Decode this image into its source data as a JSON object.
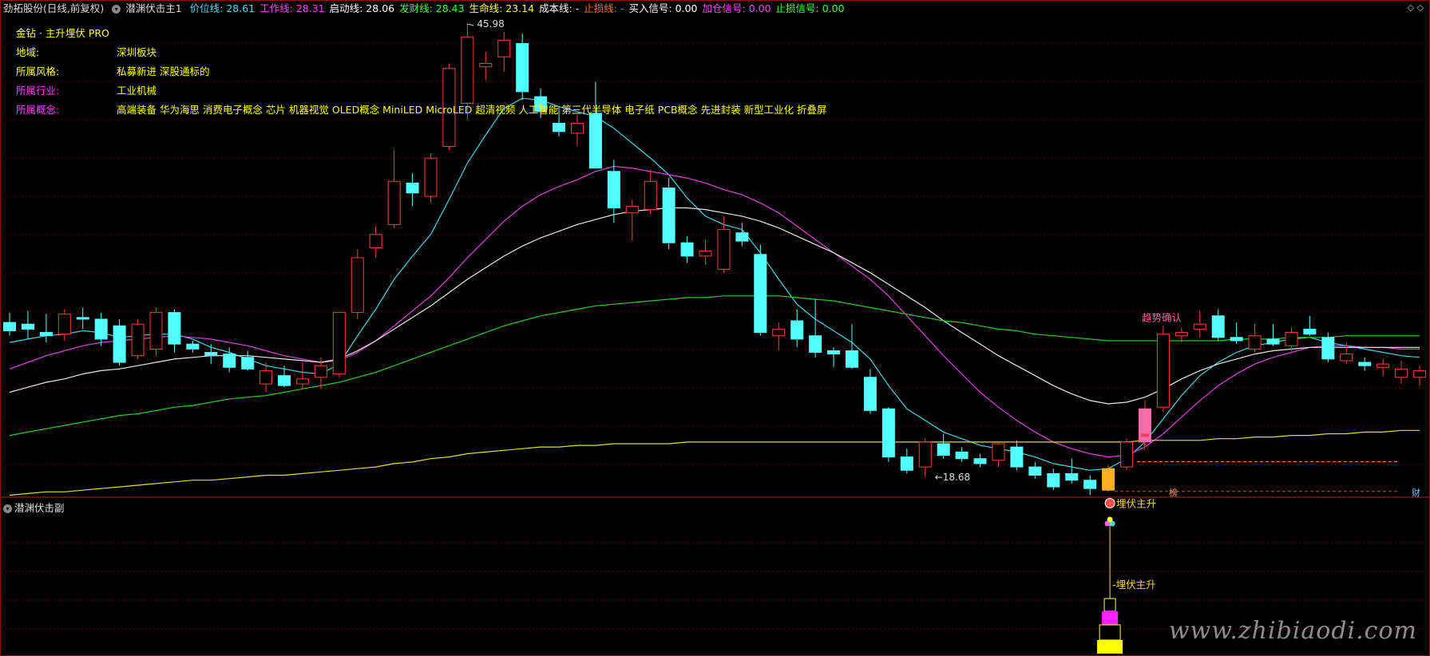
{
  "header": {
    "title": "劲拓股份(日线,前复权)",
    "indicator_name": "潜渊伏击主1",
    "values": [
      {
        "label": "价位线: 28.61",
        "color": "#4fd8ff"
      },
      {
        "label": "工作线: 28.31",
        "color": "#ff40ff"
      },
      {
        "label": "启动线: 28.06",
        "color": "#ffffff"
      },
      {
        "label": "发财线: 28.43",
        "color": "#33ff33"
      },
      {
        "label": "生命线: 23.14",
        "color": "#ffff40"
      },
      {
        "label": "成本线: -",
        "color": "#ffffff"
      },
      {
        "label": "止损线: -",
        "color": "#ff6a00"
      },
      {
        "label": "买入信号: 0.00",
        "color": "#ffffff"
      },
      {
        "label": "加仓信号: 0.00",
        "color": "#ff40ff"
      },
      {
        "label": "止损信号: 0.00",
        "color": "#33ff33"
      }
    ]
  },
  "info": {
    "title": "金钻 · 主升埋伏 PRO",
    "rows": [
      {
        "key": "地域:",
        "value": "深圳板块",
        "key_color": "#ffff40"
      },
      {
        "key": "所属风格:",
        "value": "私募新进 深股通标的",
        "key_color": "#ffff40"
      },
      {
        "key": "所属行业:",
        "value": "工业机械",
        "key_color": "#ff40ff"
      },
      {
        "key": "所属概念:",
        "value": "高端装备 华为海思 消费电子概念 芯片 机器视觉 OLED概念 MiniLED MicroLED 超清视频 人工智能 第三代半导体 电子纸 PCB概念 先进封装 新型工业化 折叠屏",
        "key_color": "#ff40ff"
      }
    ]
  },
  "annotations": {
    "high": "45.98",
    "low": "18.68",
    "trend_confirm": "趋势确认",
    "ambush": "埋伏主升",
    "ambush_sub": "埋伏主升",
    "badge_left": "榜",
    "badge_right": "财"
  },
  "sub_panel": {
    "title": "潜渊伏击副"
  },
  "watermark": "www.zhibiaodi.com",
  "chart_data": {
    "type": "candlestick",
    "price_range": [
      18.68,
      45.98
    ],
    "candles": [
      {
        "o": 28.0,
        "h": 28.6,
        "l": 27.2,
        "c": 27.5
      },
      {
        "o": 27.9,
        "h": 28.7,
        "l": 27.0,
        "c": 27.6
      },
      {
        "o": 27.4,
        "h": 28.5,
        "l": 26.8,
        "c": 27.2
      },
      {
        "o": 27.3,
        "h": 28.8,
        "l": 26.9,
        "c": 28.5
      },
      {
        "o": 28.3,
        "h": 28.9,
        "l": 27.6,
        "c": 28.2
      },
      {
        "o": 28.2,
        "h": 28.6,
        "l": 26.6,
        "c": 27.0
      },
      {
        "o": 27.8,
        "h": 28.2,
        "l": 25.4,
        "c": 25.6
      },
      {
        "o": 26.0,
        "h": 28.2,
        "l": 25.8,
        "c": 27.9
      },
      {
        "o": 26.4,
        "h": 28.9,
        "l": 26.0,
        "c": 28.6
      },
      {
        "o": 28.6,
        "h": 28.8,
        "l": 26.2,
        "c": 26.7
      },
      {
        "o": 26.7,
        "h": 26.9,
        "l": 26.2,
        "c": 26.4
      },
      {
        "o": 26.2,
        "h": 26.7,
        "l": 25.5,
        "c": 26.0
      },
      {
        "o": 26.1,
        "h": 26.5,
        "l": 25.0,
        "c": 25.3
      },
      {
        "o": 25.9,
        "h": 26.3,
        "l": 25.1,
        "c": 25.2
      },
      {
        "o": 24.3,
        "h": 25.6,
        "l": 23.8,
        "c": 25.1
      },
      {
        "o": 24.8,
        "h": 25.4,
        "l": 24.1,
        "c": 24.2
      },
      {
        "o": 24.3,
        "h": 25.6,
        "l": 24.0,
        "c": 24.6
      },
      {
        "o": 24.7,
        "h": 25.9,
        "l": 24.0,
        "c": 25.4
      },
      {
        "o": 24.9,
        "h": 27.1,
        "l": 24.7,
        "c": 28.6
      },
      {
        "o": 28.6,
        "h": 32.4,
        "l": 28.2,
        "c": 31.9
      },
      {
        "o": 32.5,
        "h": 33.8,
        "l": 31.9,
        "c": 33.3
      },
      {
        "o": 33.9,
        "h": 38.4,
        "l": 33.7,
        "c": 36.5
      },
      {
        "o": 36.4,
        "h": 37.0,
        "l": 35.0,
        "c": 35.8
      },
      {
        "o": 35.6,
        "h": 38.2,
        "l": 35.2,
        "c": 37.9
      },
      {
        "o": 38.6,
        "h": 43.6,
        "l": 38.4,
        "c": 43.3
      },
      {
        "o": 41.2,
        "h": 45.98,
        "l": 40.2,
        "c": 45.2
      },
      {
        "o": 43.4,
        "h": 44.3,
        "l": 42.6,
        "c": 43.6
      },
      {
        "o": 44.0,
        "h": 45.5,
        "l": 43.1,
        "c": 45.0
      },
      {
        "o": 44.8,
        "h": 45.4,
        "l": 41.4,
        "c": 41.9
      },
      {
        "o": 41.6,
        "h": 42.1,
        "l": 40.3,
        "c": 40.7
      },
      {
        "o": 40.0,
        "h": 41.0,
        "l": 39.2,
        "c": 39.5
      },
      {
        "o": 39.4,
        "h": 40.5,
        "l": 38.6,
        "c": 40.0
      },
      {
        "o": 40.6,
        "h": 42.5,
        "l": 38.4,
        "c": 37.3
      },
      {
        "o": 37.1,
        "h": 37.8,
        "l": 34.0,
        "c": 34.9
      },
      {
        "o": 34.6,
        "h": 35.4,
        "l": 32.9,
        "c": 35.0
      },
      {
        "o": 34.8,
        "h": 37.2,
        "l": 34.5,
        "c": 36.5
      },
      {
        "o": 36.1,
        "h": 36.7,
        "l": 32.4,
        "c": 32.8
      },
      {
        "o": 32.8,
        "h": 33.2,
        "l": 31.6,
        "c": 32.0
      },
      {
        "o": 32.0,
        "h": 33.0,
        "l": 31.5,
        "c": 32.3
      },
      {
        "o": 31.2,
        "h": 34.4,
        "l": 31.0,
        "c": 33.6
      },
      {
        "o": 33.4,
        "h": 34.0,
        "l": 32.6,
        "c": 32.9
      },
      {
        "o": 32.1,
        "h": 32.7,
        "l": 27.2,
        "c": 27.4
      },
      {
        "o": 27.2,
        "h": 28.0,
        "l": 26.3,
        "c": 27.6
      },
      {
        "o": 28.1,
        "h": 28.8,
        "l": 26.5,
        "c": 27.0
      },
      {
        "o": 27.2,
        "h": 29.4,
        "l": 25.9,
        "c": 26.2
      },
      {
        "o": 26.3,
        "h": 26.5,
        "l": 25.3,
        "c": 26.1
      },
      {
        "o": 26.3,
        "h": 27.9,
        "l": 25.2,
        "c": 25.3
      },
      {
        "o": 24.7,
        "h": 25.2,
        "l": 22.5,
        "c": 22.7
      },
      {
        "o": 22.8,
        "h": 22.9,
        "l": 19.6,
        "c": 19.9
      },
      {
        "o": 19.9,
        "h": 20.4,
        "l": 18.9,
        "c": 19.1
      },
      {
        "o": 19.3,
        "h": 21.0,
        "l": 18.68,
        "c": 20.8
      },
      {
        "o": 20.7,
        "h": 21.3,
        "l": 19.8,
        "c": 20.0
      },
      {
        "o": 20.2,
        "h": 20.5,
        "l": 19.6,
        "c": 19.8
      },
      {
        "o": 19.8,
        "h": 20.1,
        "l": 19.3,
        "c": 19.5
      },
      {
        "o": 19.7,
        "h": 20.8,
        "l": 19.3,
        "c": 20.7
      },
      {
        "o": 20.5,
        "h": 20.9,
        "l": 19.1,
        "c": 19.3
      },
      {
        "o": 19.3,
        "h": 19.6,
        "l": 18.6,
        "c": 18.8
      },
      {
        "o": 18.9,
        "h": 19.2,
        "l": 17.9,
        "c": 18.1
      },
      {
        "o": 18.9,
        "h": 19.8,
        "l": 18.3,
        "c": 18.5
      },
      {
        "o": 18.5,
        "h": 18.8,
        "l": 17.6,
        "c": 18.0
      },
      {
        "o": 17.9,
        "h": 19.4,
        "l": 17.8,
        "c": 19.2
      },
      {
        "o": 19.3,
        "h": 21.0,
        "l": 19.1,
        "c": 20.8
      },
      {
        "o": 20.8,
        "h": 23.3,
        "l": 20.6,
        "c": 22.8
      },
      {
        "o": 22.9,
        "h": 27.8,
        "l": 22.6,
        "c": 27.3
      },
      {
        "o": 27.2,
        "h": 27.7,
        "l": 26.8,
        "c": 27.4
      },
      {
        "o": 27.6,
        "h": 28.7,
        "l": 27.1,
        "c": 27.9
      },
      {
        "o": 28.4,
        "h": 28.8,
        "l": 26.9,
        "c": 27.1
      },
      {
        "o": 27.1,
        "h": 28.0,
        "l": 26.7,
        "c": 26.9
      },
      {
        "o": 26.4,
        "h": 27.9,
        "l": 26.2,
        "c": 27.2
      },
      {
        "o": 27.0,
        "h": 27.9,
        "l": 26.6,
        "c": 26.7
      },
      {
        "o": 26.6,
        "h": 27.7,
        "l": 26.3,
        "c": 27.4
      },
      {
        "o": 27.6,
        "h": 28.4,
        "l": 27.2,
        "c": 27.3
      },
      {
        "o": 27.1,
        "h": 27.4,
        "l": 25.6,
        "c": 25.8
      },
      {
        "o": 25.7,
        "h": 26.8,
        "l": 25.5,
        "c": 26.1
      },
      {
        "o": 25.6,
        "h": 25.9,
        "l": 25.1,
        "c": 25.4
      },
      {
        "o": 25.3,
        "h": 25.8,
        "l": 24.8,
        "c": 25.5
      },
      {
        "o": 24.7,
        "h": 25.7,
        "l": 24.3,
        "c": 25.2
      },
      {
        "o": 24.7,
        "h": 25.4,
        "l": 24.2,
        "c": 25.1
      }
    ],
    "lines": [
      {
        "name": "价位线",
        "color": "#3fd6e8",
        "values": [
          26.8,
          27.0,
          27.2,
          27.3,
          27.5,
          27.4,
          27.1,
          27.2,
          27.3,
          27.3,
          27.0,
          26.5,
          26.2,
          25.8,
          25.4,
          25.2,
          25.0,
          24.9,
          25.5,
          27.2,
          28.8,
          30.6,
          32.0,
          33.3,
          35.4,
          37.6,
          39.3,
          40.9,
          41.5,
          41.4,
          41.0,
          40.7,
          40.4,
          39.7,
          38.8,
          37.9,
          36.9,
          35.5,
          34.4,
          33.9,
          33.6,
          32.2,
          30.6,
          29.1,
          28.2,
          27.5,
          26.8,
          25.8,
          24.2,
          22.8,
          22.1,
          21.4,
          21.0,
          20.6,
          20.4,
          20.2,
          19.9,
          19.5,
          19.3,
          19.1,
          19.2,
          19.8,
          20.8,
          22.2,
          23.6,
          24.8,
          25.6,
          26.2,
          26.6,
          26.8,
          27.0,
          27.1,
          26.8,
          26.6,
          26.4,
          26.2,
          26.0,
          25.9
        ]
      },
      {
        "name": "工作线",
        "color": "#e040e0",
        "values": [
          25.2,
          25.6,
          26.0,
          26.3,
          26.6,
          26.8,
          26.9,
          27.0,
          27.1,
          27.2,
          27.1,
          27.0,
          26.8,
          26.6,
          26.3,
          26.0,
          25.8,
          25.6,
          25.7,
          26.2,
          26.9,
          27.8,
          28.7,
          29.6,
          30.7,
          31.9,
          33.0,
          34.1,
          35.0,
          35.7,
          36.2,
          36.6,
          37.1,
          37.4,
          37.3,
          37.1,
          36.9,
          36.7,
          36.4,
          36.0,
          35.7,
          35.2,
          34.6,
          33.8,
          33.0,
          32.2,
          31.4,
          30.6,
          29.6,
          28.4,
          27.2,
          26.0,
          24.9,
          23.8,
          22.9,
          22.1,
          21.4,
          20.8,
          20.4,
          20.1,
          19.9,
          20.0,
          20.5,
          21.3,
          22.3,
          23.3,
          24.2,
          24.9,
          25.5,
          25.9,
          26.2,
          26.5,
          26.6,
          26.6,
          26.5,
          26.5,
          26.4,
          26.4
        ]
      },
      {
        "name": "启动线",
        "color": "#e8e8e8",
        "values": [
          23.8,
          24.1,
          24.4,
          24.6,
          24.9,
          25.1,
          25.2,
          25.4,
          25.6,
          25.8,
          25.9,
          26.0,
          26.0,
          26.0,
          25.9,
          25.8,
          25.7,
          25.6,
          25.8,
          26.3,
          26.9,
          27.6,
          28.3,
          29.0,
          29.8,
          30.6,
          31.3,
          32.0,
          32.6,
          33.1,
          33.5,
          33.9,
          34.2,
          34.5,
          34.7,
          34.8,
          34.9,
          34.9,
          34.8,
          34.6,
          34.4,
          34.1,
          33.7,
          33.2,
          32.7,
          32.2,
          31.6,
          31.0,
          30.3,
          29.6,
          28.9,
          28.1,
          27.4,
          26.7,
          26.0,
          25.4,
          24.8,
          24.2,
          23.7,
          23.3,
          23.1,
          23.2,
          23.5,
          24.0,
          24.6,
          25.1,
          25.5,
          25.8,
          26.1,
          26.3,
          26.4,
          26.5,
          26.5,
          26.5,
          26.5,
          26.5,
          26.5,
          26.5
        ]
      },
      {
        "name": "发财线",
        "color": "#22cc22",
        "values": [
          21.2,
          21.4,
          21.6,
          21.8,
          22.0,
          22.2,
          22.4,
          22.5,
          22.7,
          22.9,
          23.0,
          23.2,
          23.4,
          23.5,
          23.6,
          23.8,
          24.0,
          24.2,
          24.4,
          24.7,
          25.0,
          25.4,
          25.8,
          26.2,
          26.6,
          27.0,
          27.4,
          27.8,
          28.1,
          28.4,
          28.6,
          28.8,
          29.0,
          29.1,
          29.2,
          29.3,
          29.4,
          29.5,
          29.5,
          29.6,
          29.6,
          29.6,
          29.6,
          29.5,
          29.4,
          29.3,
          29.1,
          28.9,
          28.7,
          28.5,
          28.3,
          28.1,
          28.0,
          27.8,
          27.6,
          27.5,
          27.3,
          27.2,
          27.1,
          27.0,
          26.9,
          26.9,
          26.9,
          26.9,
          26.9,
          26.9,
          26.9,
          27.0,
          27.0,
          27.0,
          27.1,
          27.1,
          27.1,
          27.2,
          27.2,
          27.2,
          27.2,
          27.2
        ]
      },
      {
        "name": "生命线",
        "color": "#e0e020",
        "values": [
          17.6,
          17.7,
          17.8,
          17.8,
          17.9,
          18.0,
          18.1,
          18.2,
          18.3,
          18.4,
          18.5,
          18.5,
          18.6,
          18.7,
          18.8,
          18.8,
          18.9,
          19.0,
          19.1,
          19.2,
          19.3,
          19.5,
          19.6,
          19.8,
          19.9,
          20.1,
          20.2,
          20.3,
          20.4,
          20.5,
          20.5,
          20.6,
          20.6,
          20.7,
          20.7,
          20.7,
          20.7,
          20.8,
          20.8,
          20.8,
          20.8,
          20.8,
          20.8,
          20.8,
          20.8,
          20.8,
          20.8,
          20.8,
          20.8,
          20.8,
          20.8,
          20.8,
          20.8,
          20.8,
          20.8,
          20.8,
          20.8,
          20.8,
          20.8,
          20.8,
          20.8,
          20.8,
          20.9,
          20.9,
          20.9,
          20.9,
          21.0,
          21.0,
          21.1,
          21.1,
          21.2,
          21.2,
          21.3,
          21.3,
          21.4,
          21.4,
          21.5,
          21.5
        ]
      }
    ],
    "signals": {
      "buy_index": 60,
      "confirm_index": 62,
      "stop_level": 18.5,
      "entry_level": 20.0
    }
  }
}
